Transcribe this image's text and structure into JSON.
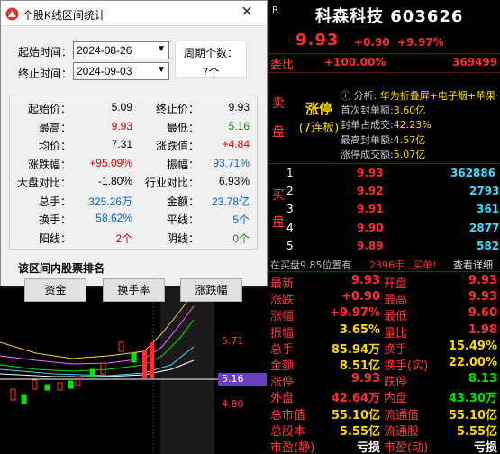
{
  "chart": {
    "price_labels": [
      "5.71",
      "4.80"
    ],
    "current_price_label": "5.16"
  },
  "dialog": {
    "title": "个股K线区间统计",
    "start_label": "起始时间：",
    "start_value": "2024-08-26",
    "end_label": "终止时间：",
    "end_value": "2024-09-03",
    "period_label": "周期个数：",
    "period_value": "7个",
    "stats": [
      {
        "l": "起始价：",
        "lv": "5.09",
        "lc": "black",
        "r": "终止价：",
        "rv": "9.93",
        "rc": "black"
      },
      {
        "l": "最高：",
        "lv": "9.93",
        "lc": "red",
        "r": "最低：",
        "rv": "5.16",
        "rc": "green"
      },
      {
        "l": "均价：",
        "lv": "7.31",
        "lc": "black",
        "r": "涨跌值：",
        "rv": "+4.84",
        "rc": "red"
      },
      {
        "l": "涨跌幅：",
        "lv": "+95.09%",
        "lc": "red",
        "r": "振幅：",
        "rv": "93.71%",
        "rc": "blue"
      },
      {
        "l": "大盘对比：",
        "lv": "-1.80%",
        "lc": "black",
        "r": "行业对比：",
        "rv": "6.93%",
        "rc": "black"
      },
      {
        "l": "总手：",
        "lv": "325.26万",
        "lc": "blue",
        "r": "金额：",
        "rv": "23.78亿",
        "rc": "blue"
      },
      {
        "l": "换手：",
        "lv": "58.62%",
        "lc": "blue",
        "r": "平线：",
        "rv": "5个",
        "rc": "blue"
      },
      {
        "l": "阳线：",
        "lv": "2个",
        "lc": "red",
        "r": "阴线：",
        "rv": "0个",
        "rc": "green"
      }
    ],
    "rank_label": "该区间内股票排名",
    "buttons": [
      "资金",
      "换手率",
      "涨跌幅"
    ]
  },
  "quote": {
    "r_mark": "R",
    "title": "科森科技 603626",
    "price": "9.93",
    "change": "+0.90",
    "pct": "+9.97%",
    "weibi_label": "委比",
    "weibi_pct": "+100.00%",
    "weibi_val": "369499",
    "sell_side": [
      "卖",
      "盘"
    ],
    "limit_text": "涨停",
    "limit_sub": "(7连板)",
    "analysis_label": "分析:",
    "analysis_value": "华为折叠屏+电子烟+苹果",
    "info_lines": [
      {
        "k": "首次封单额:",
        "v": "3.60亿"
      },
      {
        "k": "封单占成交:",
        "v": "42.23%"
      },
      {
        "k": "最高封单额:",
        "v": "4.57亿"
      },
      {
        "k": "涨停成交额:",
        "v": "5.07亿"
      }
    ],
    "buy_side": [
      "买",
      "盘"
    ],
    "bids": [
      {
        "n": "1",
        "p": "9.93",
        "v": "362886"
      },
      {
        "n": "2",
        "p": "9.92",
        "v": "2793"
      },
      {
        "n": "3",
        "p": "9.91",
        "v": "361"
      },
      {
        "n": "4",
        "p": "9.90",
        "v": "2877"
      },
      {
        "n": "5",
        "p": "9.89",
        "v": "582"
      }
    ],
    "foot_text": "在买盘9.85位置有",
    "foot_num": "2396手",
    "foot_tag": "买单!",
    "foot_link": "查看详细",
    "stats": [
      {
        "l": "最新",
        "lv": "9.93",
        "lc": "red",
        "r": "开盘",
        "rv": "9.93",
        "rc": "red"
      },
      {
        "l": "涨跌",
        "lv": "+0.90",
        "lc": "red",
        "r": "最高",
        "rv": "9.93",
        "rc": "red"
      },
      {
        "l": "涨幅",
        "lv": "+9.97%",
        "lc": "red",
        "r": "最低",
        "rv": "9.60",
        "rc": "red"
      },
      {
        "l": "振幅",
        "lv": "3.65%",
        "lc": "yellow",
        "r": "量比",
        "rv": "1.98",
        "rc": "red"
      },
      {
        "l": "总手",
        "lv": "85.94万",
        "lc": "yellow",
        "r": "换手",
        "rv": "15.49%",
        "rc": "yellow"
      },
      {
        "l": "金额",
        "lv": "8.51亿",
        "lc": "yellow",
        "r": "换手(实)",
        "rv": "22.00%",
        "rc": "yellow"
      },
      {
        "l": "涨停",
        "lv": "9.93",
        "lc": "red",
        "r": "跌停",
        "rv": "8.13",
        "rc": "green"
      },
      {
        "l": "外盘",
        "lv": "42.64万",
        "lc": "red",
        "r": "内盘",
        "rv": "43.30万",
        "rc": "green"
      },
      {
        "l": "总市值",
        "lv": "55.10亿",
        "lc": "yellow",
        "r": "流通值",
        "rv": "55.10亿",
        "rc": "yellow"
      },
      {
        "l": "总股本",
        "lv": "5.55亿",
        "lc": "yellow",
        "r": "流通股",
        "rv": "5.55亿",
        "rc": "yellow"
      },
      {
        "l": "市盈(静)",
        "lv": "亏损",
        "lc": "white",
        "r": "市盈(动)",
        "rv": "亏损",
        "rc": "white"
      }
    ]
  },
  "colors": {
    "up": "#ff2e2e",
    "down": "#00e600",
    "accent": "#ffd700",
    "blue": "#0066cc"
  }
}
